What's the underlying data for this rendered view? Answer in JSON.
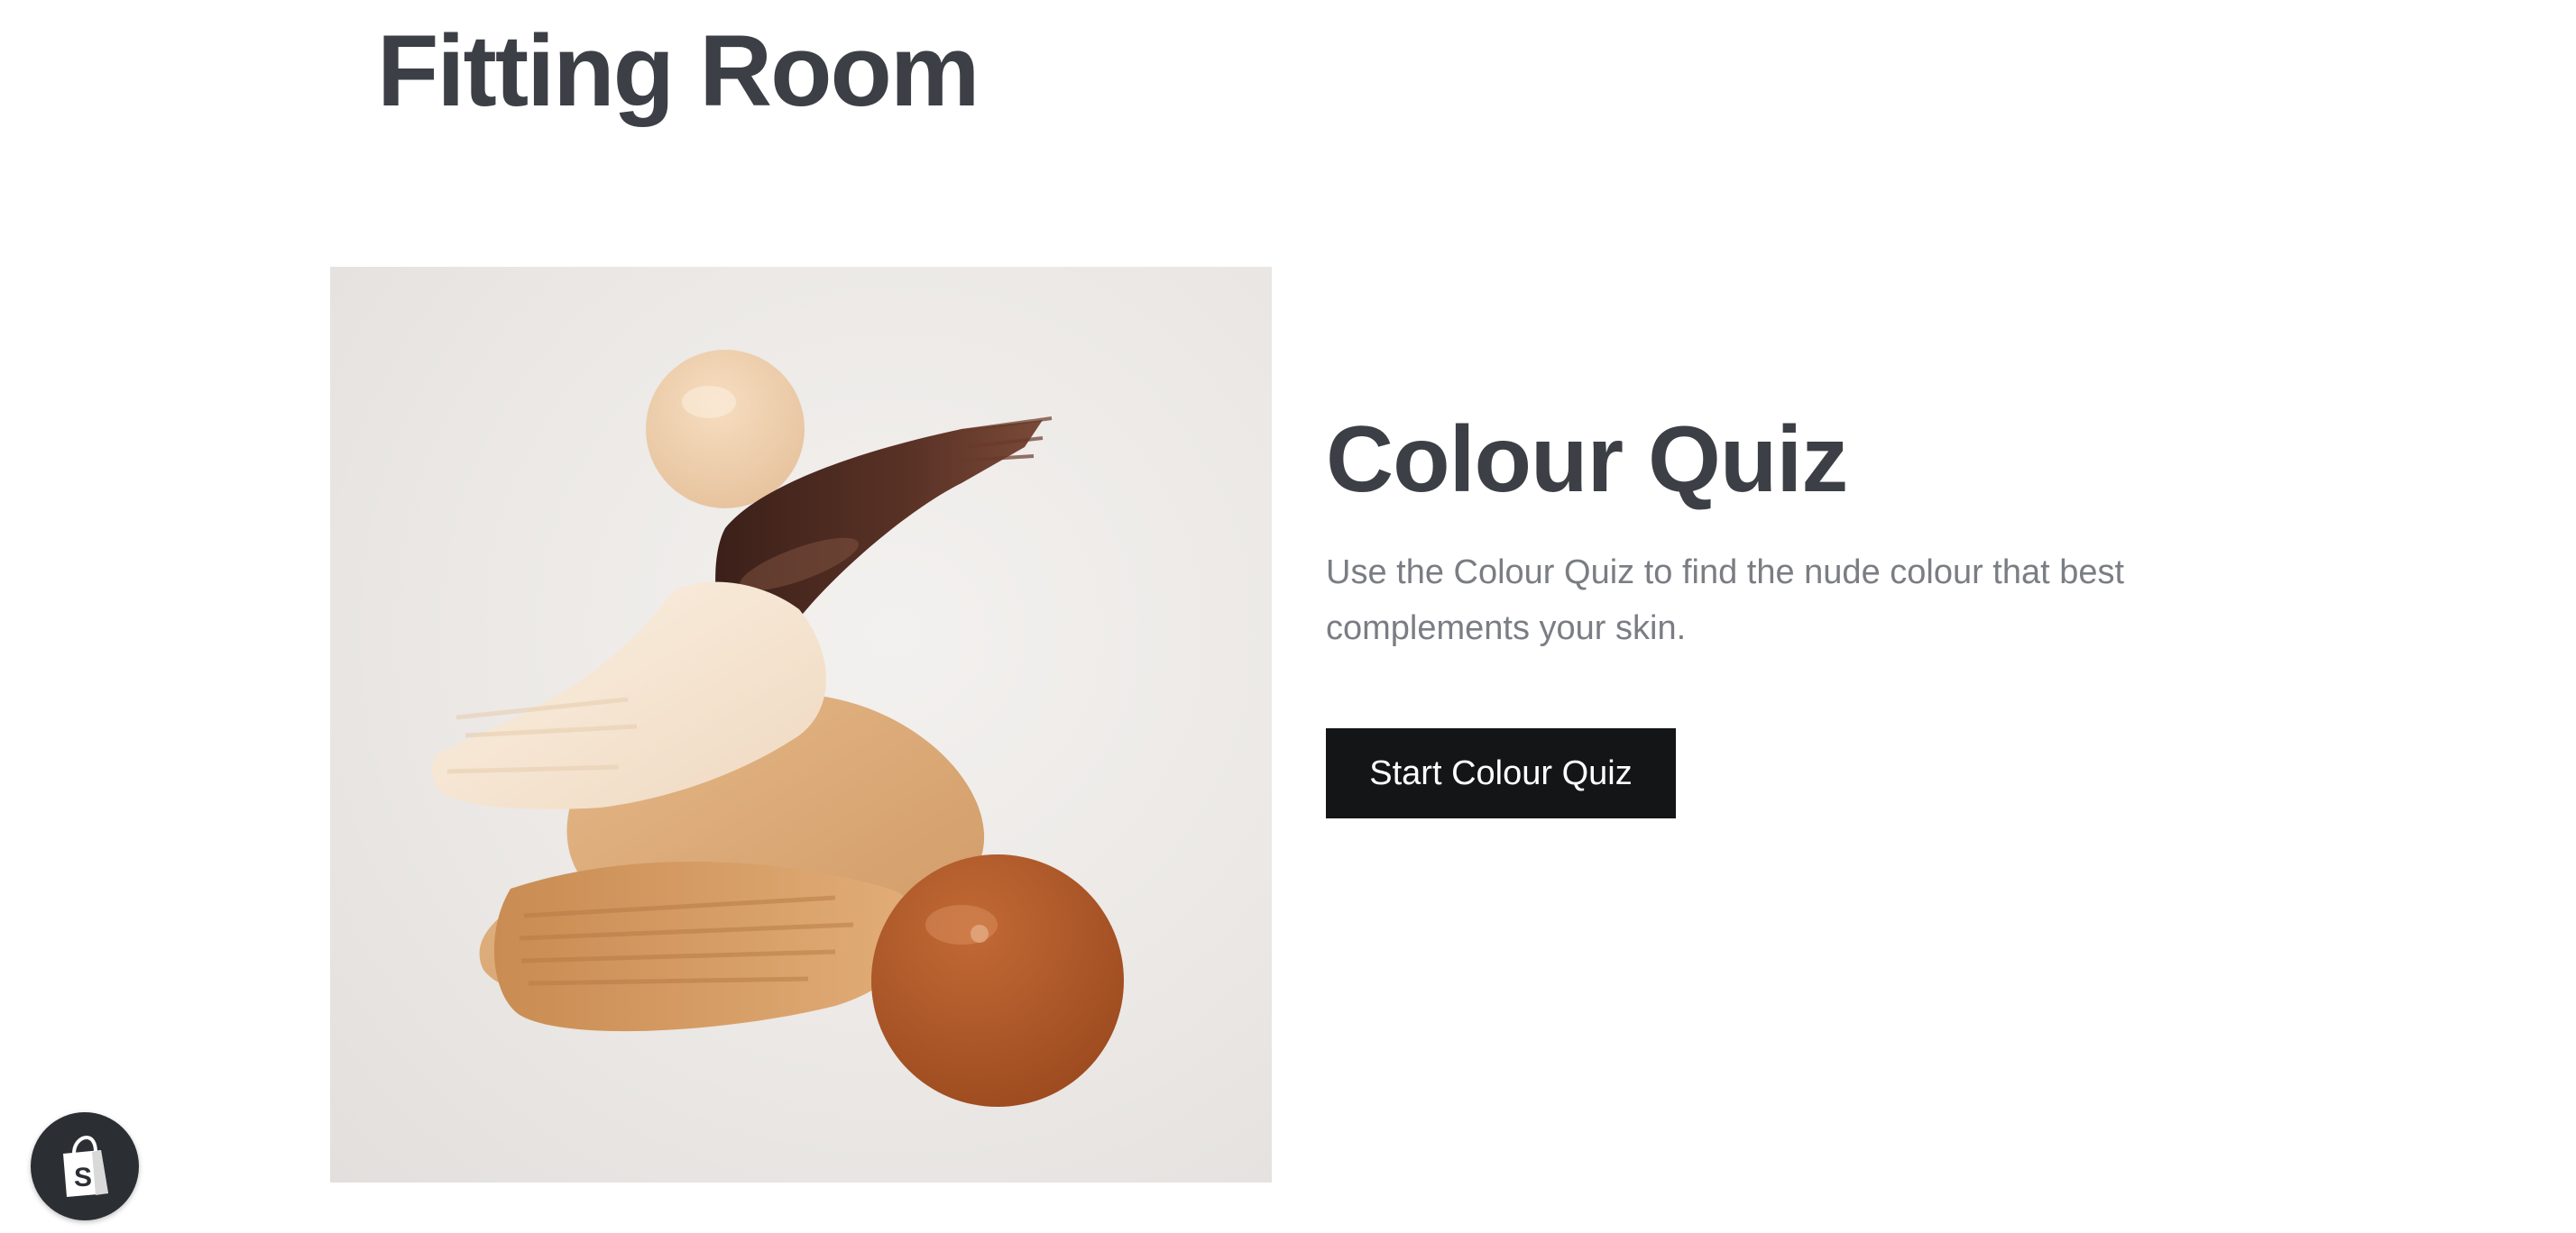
{
  "page": {
    "title": "Fitting Room"
  },
  "quiz": {
    "title": "Colour Quiz",
    "description": "Use the Colour Quiz to find the nude colour that best complements your skin.",
    "button_label": "Start Colour Quiz"
  },
  "hero_image": {
    "subject": "foundation-swatches-image"
  },
  "shopify_badge": {
    "icon": "shopify-bag-icon"
  },
  "colors": {
    "heading": "#3c3f45",
    "body_text": "#7a7d83",
    "button_bg": "#141517",
    "button_text": "#ffffff",
    "badge_bg": "#2b2e33"
  }
}
